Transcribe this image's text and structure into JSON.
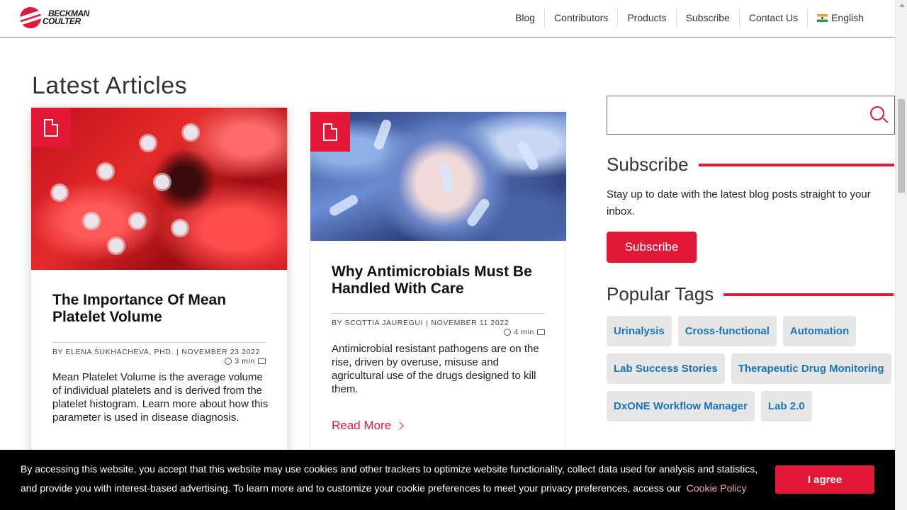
{
  "header": {
    "logo": {
      "line1": "BECKMAN",
      "line2": "COULTER"
    },
    "nav": [
      {
        "label": "Blog"
      },
      {
        "label": "Contributors"
      },
      {
        "label": "Products"
      },
      {
        "label": "Subscribe"
      },
      {
        "label": "Contact Us"
      }
    ],
    "language": "English"
  },
  "main": {
    "title": "Latest Articles",
    "articles": [
      {
        "title": "The Importance Of Mean Platelet Volume",
        "author": "BY ELENA SUKHACHEVA, PHD.",
        "date": "NOVEMBER 23 2022",
        "read_time": "3 min",
        "excerpt": "Mean Platelet Volume is the average volume of individual platelets and is derived from the platelet histogram. Learn more about how this parameter is used in disease diagnosis."
      },
      {
        "title": "Why Antimicrobials Must Be Handled With Care",
        "author": "BY SCOTTIA JAUREGUI",
        "date": "NOVEMBER 11 2022",
        "read_time": "4 min",
        "excerpt": "Antimicrobial resistant pathogens are on the rise, driven by overuse, misuse and agricultural use of the drugs designed to kill them.",
        "read_more": "Read More"
      }
    ]
  },
  "sidebar": {
    "search": {
      "value": "",
      "placeholder": ""
    },
    "subscribe": {
      "heading": "Subscribe",
      "text": "Stay up to date with the latest blog posts straight to your inbox.",
      "button": "Subscribe"
    },
    "tags": {
      "heading": "Popular Tags",
      "items": [
        "Urinalysis",
        "Cross-functional",
        "Automation",
        "Lab Success Stories",
        "Therapeutic Drug Monitoring",
        "DxONE Workflow Manager",
        "Lab 2.0"
      ]
    }
  },
  "cookie_banner": {
    "text": "By accessing this website, you accept that this website may use cookies and other trackers to optimize website functionality, collect data used for analysis and statistics, and provide you with interest-based advertising. To learn more and to customize your cookie preferences to meet your privacy preferences, access our",
    "link": "Cookie Policy",
    "button": "I agree"
  },
  "colors": {
    "brand_red": "#e31837",
    "tag_blue": "#1a75bb",
    "tag_bg": "#e6e6e6"
  }
}
